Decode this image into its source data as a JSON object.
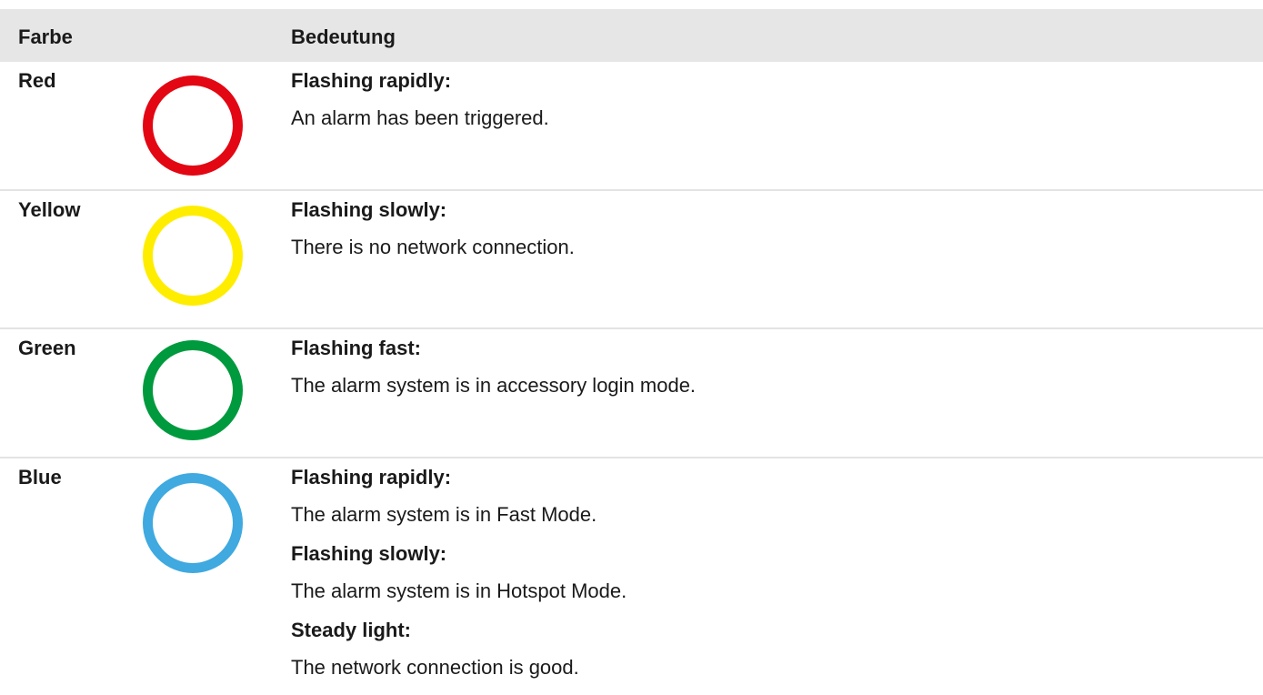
{
  "header": {
    "color_label": "Farbe",
    "meaning_label": "Bedeutung"
  },
  "rows": [
    {
      "color": "Red",
      "ring_color": "#e30613",
      "entries": [
        {
          "label": "Flashing rapidly:",
          "text": "An alarm has been triggered."
        }
      ]
    },
    {
      "color": "Yellow",
      "ring_color": "#ffed00",
      "entries": [
        {
          "label": "Flashing slowly:",
          "text": "There is no network connection."
        }
      ]
    },
    {
      "color": "Green",
      "ring_color": "#009a3e",
      "entries": [
        {
          "label": "Flashing fast:",
          "text": "The alarm system is in accessory login mode."
        }
      ]
    },
    {
      "color": "Blue",
      "ring_color": "#3fa9e0",
      "entries": [
        {
          "label": "Flashing rapidly:",
          "text": "The alarm system is in Fast Mode."
        },
        {
          "label": "Flashing slowly:",
          "text": "The alarm system is in Hotspot Mode."
        },
        {
          "label": "Steady light:",
          "text": "The network connection is good."
        }
      ]
    }
  ]
}
